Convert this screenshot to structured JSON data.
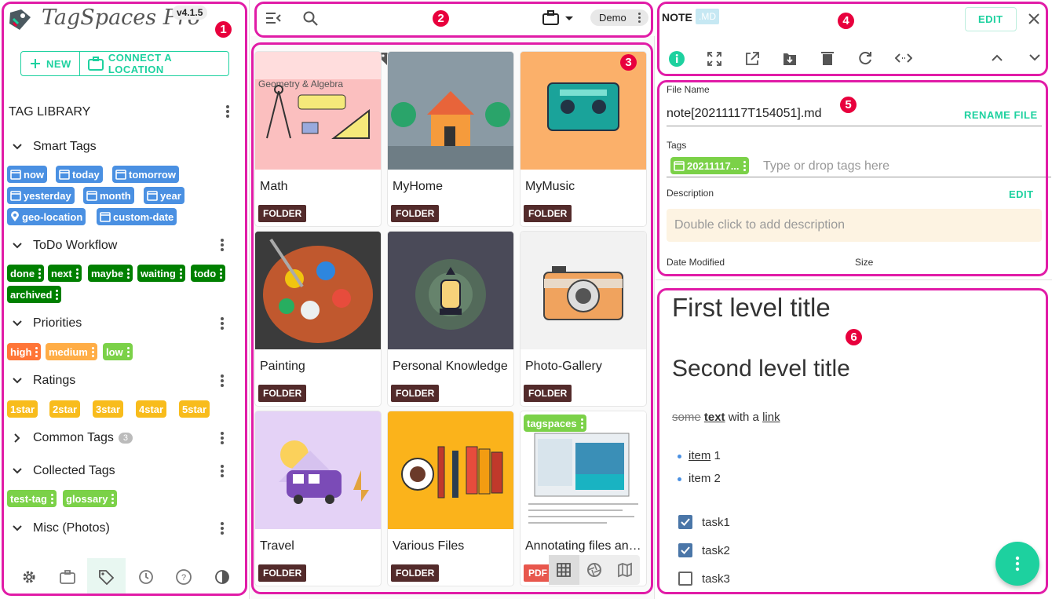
{
  "sidebar": {
    "app_name": "TagSpaces Pro",
    "version": "v4.1.5",
    "new_label": "NEW",
    "connect_label": "CONNECT A LOCATION",
    "library_title": "TAG LIBRARY",
    "groups": [
      {
        "name": "Smart Tags",
        "tags": [
          "now",
          "today",
          "tomorrow",
          "yesterday",
          "month",
          "year",
          "geo-location",
          "custom-date"
        ]
      },
      {
        "name": "ToDo Workflow",
        "tags": [
          "done",
          "next",
          "maybe",
          "waiting",
          "todo",
          "archived"
        ]
      },
      {
        "name": "Priorities",
        "tags": [
          "high",
          "medium",
          "low"
        ]
      },
      {
        "name": "Ratings",
        "tags": [
          "1star",
          "2star",
          "3star",
          "4star",
          "5star"
        ]
      },
      {
        "name": "Common Tags",
        "count": "3"
      },
      {
        "name": "Collected Tags",
        "tags": [
          "test-tag",
          "glossary"
        ]
      },
      {
        "name": "Misc (Photos)"
      }
    ]
  },
  "middle": {
    "location": "Demo",
    "grid": [
      {
        "title": "Math",
        "badge": "FOLDER",
        "caption": "Geometry & Algebra"
      },
      {
        "title": "MyHome",
        "badge": "FOLDER"
      },
      {
        "title": "MyMusic",
        "badge": "FOLDER"
      },
      {
        "title": "Painting",
        "badge": "FOLDER"
      },
      {
        "title": "Personal Knowledge",
        "badge": "FOLDER"
      },
      {
        "title": "Photo-Gallery",
        "badge": "FOLDER"
      },
      {
        "title": "Travel",
        "badge": "FOLDER"
      },
      {
        "title": "Various Files",
        "badge": "FOLDER"
      },
      {
        "title": "Annotating files and folders",
        "badge": "PDF",
        "tag": "tagspaces"
      }
    ]
  },
  "right": {
    "type_label": "NOTE",
    "ext_badge": ".MD",
    "edit_label": "EDIT",
    "file_name_label": "File Name",
    "file_name": "note[20211117T154051].md",
    "rename_label": "RENAME FILE",
    "tags_label": "Tags",
    "file_tag": "20211117...",
    "tags_placeholder": "Type or drop tags here",
    "description_label": "Description",
    "description_edit": "EDIT",
    "description_placeholder": "Double click to add description",
    "date_modified_label": "Date Modified",
    "size_label": "Size",
    "content": {
      "h1": "First level title",
      "h2": "Second level title",
      "strike": "some",
      "bold": "text",
      "mid": " with a ",
      "link": "link",
      "list": [
        {
          "link": "item",
          "rest": " 1"
        },
        {
          "link": "",
          "rest": "item 2"
        }
      ],
      "tasks": [
        {
          "label": "task1",
          "checked": true
        },
        {
          "label": "task2",
          "checked": true
        },
        {
          "label": "task3",
          "checked": false
        }
      ]
    }
  },
  "annotations": [
    "1",
    "2",
    "3",
    "4",
    "5",
    "6"
  ],
  "colors": {
    "accent": "#1dd19f",
    "annotation": "#e11ca7",
    "badge_red": "#e8003d"
  }
}
